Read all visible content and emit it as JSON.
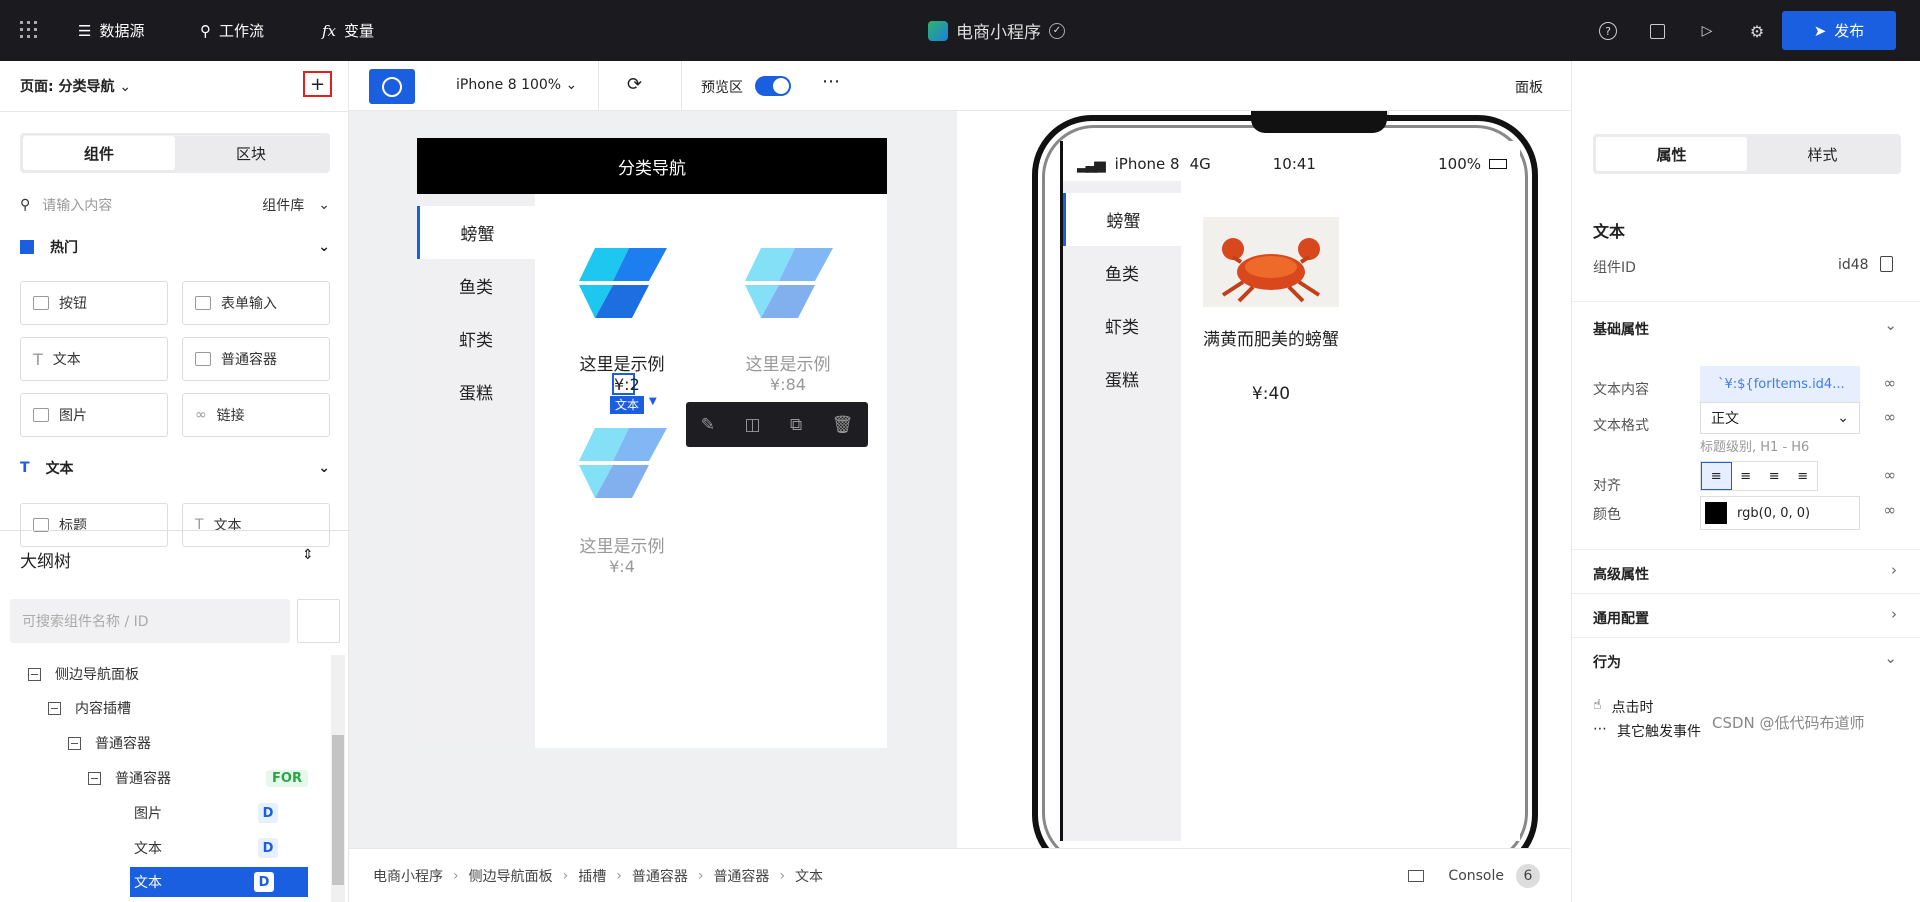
{
  "topbar": {
    "datasource": "数据源",
    "workflow": "工作流",
    "variables": "变量",
    "app_title": "电商小程序",
    "publish": "发布"
  },
  "left": {
    "page_label": "页面: 分类导航",
    "tabs": [
      "组件",
      "区块"
    ],
    "search_placeholder": "请输入内容",
    "library": "组件库",
    "hot": "热门",
    "components": [
      "按钮",
      "表单输入",
      "文本",
      "普通容器",
      "图片",
      "链接"
    ],
    "text_section": "文本",
    "text_items": [
      "标题",
      "文本"
    ],
    "outline_title": "大纲树",
    "outline_search": "可搜索组件名称 / ID",
    "tree": [
      {
        "label": "侧边导航面板"
      },
      {
        "label": "内容插槽"
      },
      {
        "label": "普通容器"
      },
      {
        "label": "普通容器",
        "badge": "FOR"
      },
      {
        "label": "图片",
        "badge": "D"
      },
      {
        "label": "文本",
        "badge": "D"
      },
      {
        "label": "文本",
        "badge": "D",
        "selected": true
      }
    ]
  },
  "toolbar": {
    "device": "iPhone 8 100%",
    "preview": "预览区",
    "panel": "面板"
  },
  "canvas": {
    "nav_title": "分类导航",
    "categories": [
      "螃蟹",
      "鱼类",
      "虾类",
      "蛋糕"
    ],
    "cards": [
      {
        "title": "这里是示例",
        "price": "¥:2"
      },
      {
        "title": "这里是示例",
        "price": "¥:84"
      },
      {
        "title": "这里是示例",
        "price": "¥:4"
      }
    ],
    "selection_tag": "文本"
  },
  "phone": {
    "carrier": "iPhone 8",
    "network": "4G",
    "time": "10:41",
    "battery": "100%",
    "categories": [
      "螃蟹",
      "鱼类",
      "虾类",
      "蛋糕"
    ],
    "product_title": "满黄而肥美的螃蟹",
    "product_price": "¥:40"
  },
  "breadcrumb": [
    "电商小程序",
    "侧边导航面板",
    "插槽",
    "普通容器",
    "普通容器",
    "文本"
  ],
  "console": {
    "label": "Console",
    "count": "6"
  },
  "right": {
    "tabs": [
      "属性",
      "样式"
    ],
    "comp_name": "文本",
    "comp_id_label": "组件ID",
    "comp_id": "id48",
    "basic": "基础属性",
    "content_label": "文本内容",
    "content_value": "`¥:${forItems.id4...",
    "format_label": "文本格式",
    "format_value": "正文",
    "format_hint": "标题级别, H1 - H6",
    "align_label": "对齐",
    "color_label": "颜色",
    "color_value": "rgb(0, 0, 0)",
    "advanced": "高级属性",
    "general": "通用配置",
    "behavior": "行为",
    "on_click": "点击时",
    "other_events": "其它触发事件"
  },
  "watermark": "CSDN @低代码布道师"
}
